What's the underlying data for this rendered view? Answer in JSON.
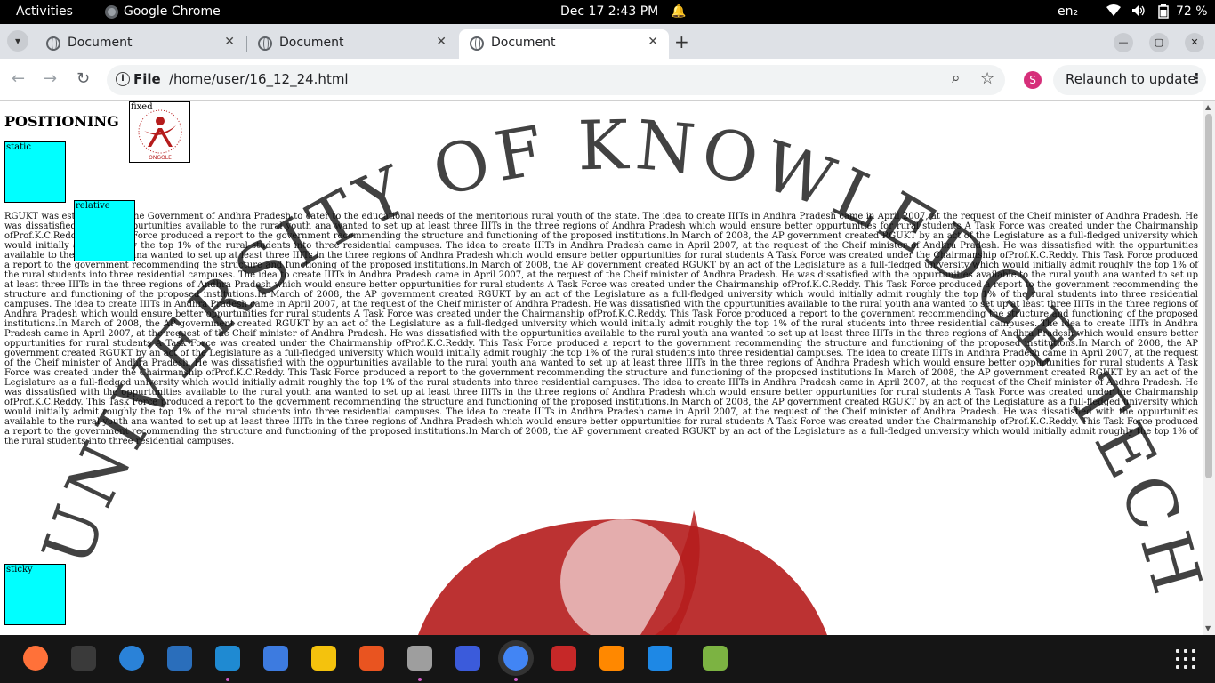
{
  "topbar": {
    "activities": "Activities",
    "app_name": "Google Chrome",
    "clock": "Dec 17  2:43 PM",
    "language": "en₂",
    "battery_pct": "72 %"
  },
  "tabs": [
    {
      "title": "Document",
      "active": false
    },
    {
      "title": "Document",
      "active": false
    },
    {
      "title": "Document",
      "active": true
    }
  ],
  "toolbar": {
    "scheme_label": "File",
    "url": "/home/user/16_12_24.html",
    "profile_initial": "S",
    "relaunch_label": "Relaunch to update"
  },
  "page": {
    "title": "POSITIONING",
    "fixed_label": "fixed",
    "static_label": "static",
    "relative_label": "relative",
    "sticky_label": "sticky",
    "logo_caption": "ONGOLE",
    "watermark_text": "UNIVERSITY OF KNOWLEDGE TECHNOLOGIES",
    "body_text": "RGUKT was established by the Government of Andhra Pradesh to cater to the educational needs of the meritorious rural youth of the state. The idea to create IIITs in Andhra Pradesh came in April 2007, at the request of the Cheif minister of Andhra Pradesh. He was dissatisfied with the oppurtunities available to the rural youth ana wanted to set up at least three IIITs in the three regions of Andhra Pradesh which would ensure better oppurtunities for rural students A Task Force was created under the Chairmanship ofProf.K.C.Reddy. This Task Force produced a report to the government recommending the structure and functioning of the proposed institutions.In March of 2008, the AP government created RGUKT by an act of the Legislature as a full-fledged university which would initially admit roughly the top 1% of the rural students into three residential campuses. The idea to create IIITs in Andhra Pradesh came in April 2007, at the request of the Cheif minister of Andhra Pradesh. He was dissatisfied with the oppurtunities available to the rural youth ana wanted to set up at least three IIITs in the three regions of Andhra Pradesh which would ensure better oppurtunities for rural students A Task Force was created under the Chairmanship ofProf.K.C.Reddy. This Task Force produced a report to the government recommending the structure and functioning of the proposed institutions.In March of 2008, the AP government created RGUKT by an act of the Legislature as a full-fledged university which would initially admit roughly the top 1% of the rural students into three residential campuses. The idea to create IIITs in Andhra Pradesh came in April 2007, at the request of the Cheif minister of Andhra Pradesh. He was dissatisfied with the oppurtunities available to the rural youth ana wanted to set up at least three IIITs in the three regions of Andhra Pradesh which would ensure better oppurtunities for rural students A Task Force was created under the Chairmanship ofProf.K.C.Reddy. This Task Force produced a report to the government recommending the structure and functioning of the proposed institutions.In March of 2008, the AP government created RGUKT by an act of the Legislature as a full-fledged university which would initially admit roughly the top 1% of the rural students into three residential campuses. The idea to create IIITs in Andhra Pradesh came in April 2007, at the request of the Cheif minister of Andhra Pradesh. He was dissatisfied with the oppurtunities available to the rural youth ana wanted to set up at least three IIITs in the three regions of Andhra Pradesh which would ensure better oppurtunities for rural students A Task Force was created under the Chairmanship ofProf.K.C.Reddy. This Task Force produced a report to the government recommending the structure and functioning of the proposed institutions.In March of 2008, the AP government created RGUKT by an act of the Legislature as a full-fledged university which would initially admit roughly the top 1% of the rural students into three residential campuses. The idea to create IIITs in Andhra Pradesh came in April 2007, at the request of the Cheif minister of Andhra Pradesh. He was dissatisfied with the oppurtunities available to the rural youth ana wanted to set up at least three IIITs in the three regions of Andhra Pradesh which would ensure better oppurtunities for rural students A Task Force was created under the Chairmanship ofProf.K.C.Reddy. This Task Force produced a report to the government recommending the structure and functioning of the proposed institutions.In March of 2008, the AP government created RGUKT by an act of the Legislature as a full-fledged university which would initially admit roughly the top 1% of the rural students into three residential campuses. The idea to create IIITs in Andhra Pradesh came in April 2007, at the request of the Cheif minister of Andhra Pradesh. He was dissatisfied with the oppurtunities available to the rural youth ana wanted to set up at least three IIITs in the three regions of Andhra Pradesh which would ensure better oppurtunities for rural students A Task Force was created under the Chairmanship ofProf.K.C.Reddy. This Task Force produced a report to the government recommending the structure and functioning of the proposed institutions.In March of 2008, the AP government created RGUKT by an act of the Legislature as a full-fledged university which would initially admit roughly the top 1% of the rural students into three residential campuses. The idea to create IIITs in Andhra Pradesh came in April 2007, at the request of the Cheif minister of Andhra Pradesh. He was dissatisfied with the oppurtunities available to the rural youth ana wanted to set up at least three IIITs in the three regions of Andhra Pradesh which would ensure better oppurtunities for rural students A Task Force was created under the Chairmanship ofProf.K.C.Reddy. This Task Force produced a report to the government recommending the structure and functioning of the proposed institutions.In March of 2008, the AP government created RGUKT by an act of the Legislature as a full-fledged university which would initially admit roughly the top 1% of the rural students into three residential campuses. The idea to create IIITs in Andhra Pradesh came in April 2007, at the request of the Cheif minister of Andhra Pradesh. He was dissatisfied with the oppurtunities available to the rural youth ana wanted to set up at least three IIITs in the three regions of Andhra Pradesh which would ensure better oppurtunities for rural students A Task Force was created under the Chairmanship ofProf.K.C.Reddy. This Task Force produced a report to the government recommending the structure and functioning of the proposed institutions.In March of 2008, the AP government created RGUKT by an act of the Legislature as a full-fledged university which would initially admit roughly the top 1% of the rural students into three residential campuses."
  },
  "colors": {
    "box_fill": "#00ffff",
    "logo_red": "#b51c1c",
    "topbar_bg": "#000000",
    "dock_bg": "#151515"
  },
  "dock": {
    "apps": [
      {
        "name": "firefox",
        "color": "#ff7139"
      },
      {
        "name": "terminal",
        "color": "#3a3a3a"
      },
      {
        "name": "thunderbird",
        "color": "#2a82d8"
      },
      {
        "name": "libreoffice-writer",
        "color": "#2a6ebb"
      },
      {
        "name": "vscode",
        "color": "#1f8ad2"
      },
      {
        "name": "text-editor",
        "color": "#3d7be0"
      },
      {
        "name": "rhythmbox",
        "color": "#f4c20d"
      },
      {
        "name": "software-center",
        "color": "#e95420"
      },
      {
        "name": "files",
        "color": "#9e9e9e"
      },
      {
        "name": "audio-app",
        "color": "#3b5bdb"
      },
      {
        "name": "chrome",
        "color": "#4285f4"
      },
      {
        "name": "inkscape-like",
        "color": "#c62828"
      },
      {
        "name": "vlc",
        "color": "#ff8800"
      },
      {
        "name": "help",
        "color": "#1e88e5"
      },
      {
        "name": "trash",
        "color": "#7cb342"
      }
    ]
  }
}
